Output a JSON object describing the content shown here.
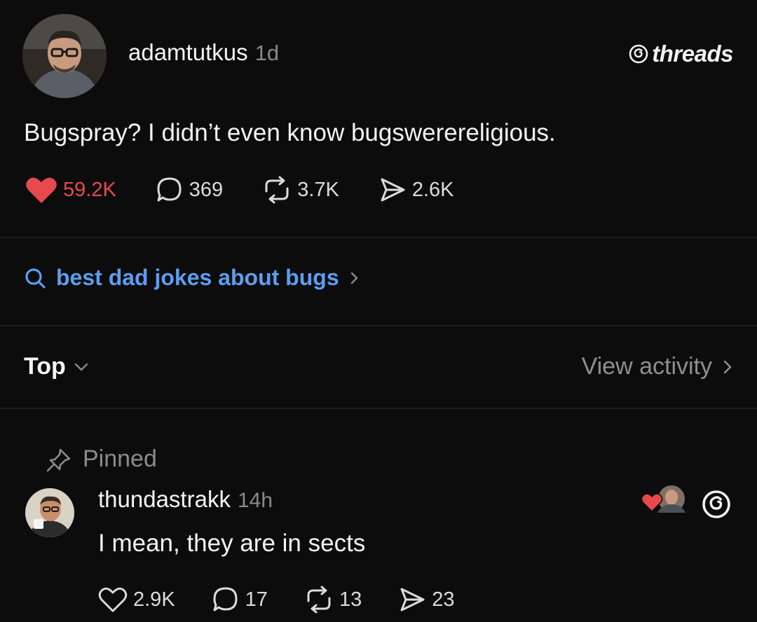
{
  "post": {
    "username": "adamtutkus",
    "time": "1d",
    "text": "Bugspray? I didn’t even know bugswerereligious.",
    "likes": "59.2K",
    "replies": "369",
    "reposts": "3.7K",
    "shares": "2.6K",
    "liked": true
  },
  "brand": {
    "name": "threads",
    "icon": "threads-logo-icon"
  },
  "search_suggestion": {
    "icon": "search-icon",
    "text": "best dad jokes about bugs"
  },
  "sort": {
    "label": "Top",
    "view_activity": "View activity"
  },
  "reply": {
    "pinned_label": "Pinned",
    "username": "thundastrakk",
    "time": "14h",
    "text": "I mean, they are in sects",
    "likes": "2.9K",
    "replies": "17",
    "reposts": "13",
    "shares": "23",
    "liked_by_author": true
  },
  "colors": {
    "background": "#0c0c0d",
    "like": "#e8494d",
    "link": "#5b9ef0",
    "muted": "#8a8a8a"
  }
}
